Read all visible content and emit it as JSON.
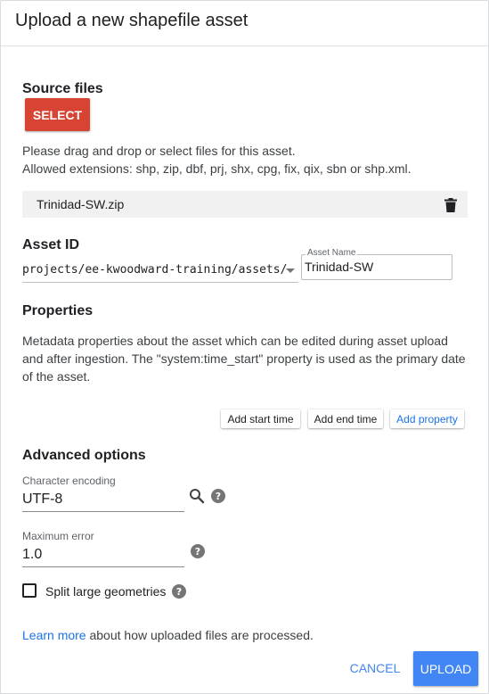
{
  "dialog": {
    "title": "Upload a new shapefile asset"
  },
  "source_files": {
    "heading": "Source files",
    "select_label": "SELECT",
    "help_line1": "Please drag and drop or select files for this asset.",
    "help_line2": "Allowed extensions: shp, zip, dbf, prj, shx, cpg, fix, qix, sbn or shp.xml.",
    "files": [
      {
        "name": "Trinidad-SW.zip",
        "icon": "trash-icon"
      }
    ]
  },
  "asset_id": {
    "heading": "Asset ID",
    "path_prefix": "projects/ee-kwoodward-training/assets/",
    "name_label": "Asset Name",
    "name_value": "Trinidad-SW"
  },
  "properties": {
    "heading": "Properties",
    "description_line1": "Metadata properties about the asset which can be edited during asset upload",
    "description_line2": "and after ingestion. The \"system:time_start\" property is used as the primary date",
    "description_line3": "of the asset.",
    "add_start_time": "Add start time",
    "add_end_time": "Add end time",
    "add_property": "Add property"
  },
  "advanced": {
    "heading": "Advanced options",
    "char_encoding_label": "Character encoding",
    "char_encoding_value": "UTF-8",
    "max_error_label": "Maximum error",
    "max_error_value": "1.0",
    "split_label": "Split large geometries",
    "split_checked": false
  },
  "footer": {
    "learn_more": "Learn more",
    "learn_more_suffix": " about how uploaded files are processed.",
    "cancel_label": "CANCEL",
    "upload_label": "UPLOAD"
  },
  "colors": {
    "select_button": "#d84434",
    "primary": "#4285f4",
    "link": "#1a73e8"
  }
}
